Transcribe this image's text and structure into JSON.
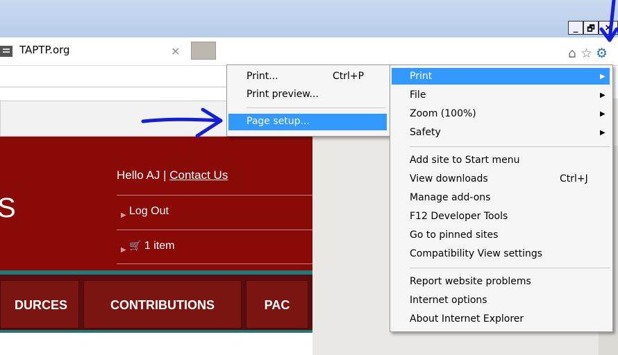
{
  "window": {
    "minimize_label": "_",
    "restore_label": "🗗",
    "close_label": "×"
  },
  "tab": {
    "title": "TAPTP.org",
    "close": "×"
  },
  "toolbar": {
    "home_icon": "⌂",
    "favorites_icon": "☆",
    "tools_icon": "⚙"
  },
  "site": {
    "logo_fragment": "S",
    "greeting_prefix": "Hello AJ | ",
    "contact_link": "Contact Us",
    "logout": "Log Out",
    "cart_count": "1 item",
    "nav": [
      "DURCES",
      "CONTRIBUTIONS",
      "PAC"
    ]
  },
  "print_submenu": {
    "items": [
      {
        "label": "Print...",
        "shortcut": "Ctrl+P"
      },
      {
        "label": "Print preview...",
        "shortcut": ""
      },
      {
        "label": "Page setup...",
        "shortcut": ""
      }
    ]
  },
  "tools_menu": {
    "group1": [
      {
        "label": "Print",
        "has_submenu": true
      },
      {
        "label": "File",
        "has_submenu": true
      },
      {
        "label": "Zoom (100%)",
        "has_submenu": true
      },
      {
        "label": "Safety",
        "has_submenu": true
      }
    ],
    "group2": [
      {
        "label": "Add site to Start menu",
        "shortcut": ""
      },
      {
        "label": "View downloads",
        "shortcut": "Ctrl+J"
      },
      {
        "label": "Manage add-ons",
        "shortcut": ""
      },
      {
        "label": "F12 Developer Tools",
        "shortcut": ""
      },
      {
        "label": "Go to pinned sites",
        "shortcut": ""
      },
      {
        "label": "Compatibility View settings",
        "shortcut": ""
      }
    ],
    "group3": [
      {
        "label": "Report website problems"
      },
      {
        "label": "Internet options"
      },
      {
        "label": "About Internet Explorer"
      }
    ]
  },
  "colors": {
    "highlight": "#3399ff",
    "site_maroon": "#8a0a07",
    "annotation_blue": "#1520d6"
  }
}
